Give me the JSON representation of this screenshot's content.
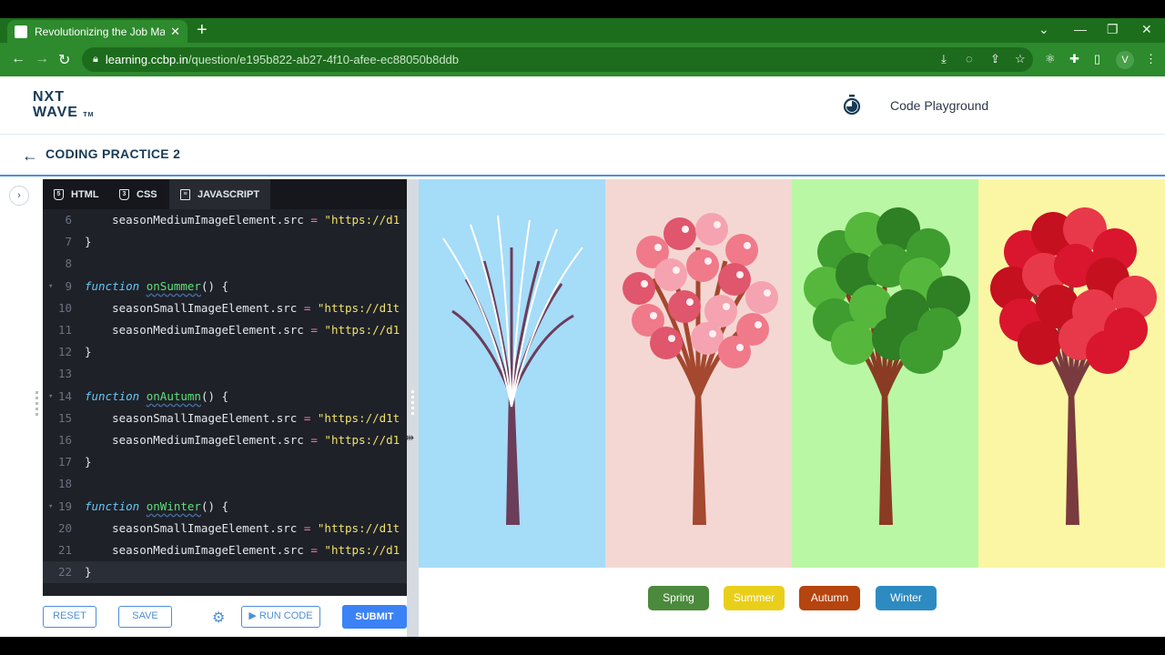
{
  "browser": {
    "tab_title": "Revolutionizing the Job Market |",
    "tab_close": "✕",
    "new_tab": "+",
    "url_host": "learning.ccbp.in",
    "url_path": "/question/e195b822-ab27-4f10-afee-ec88050b8ddb",
    "profile_initial": "V"
  },
  "header": {
    "logo_line1": "NXT",
    "logo_line2": "WAVE",
    "logo_tm": "TM",
    "playground_label": "Code Playground"
  },
  "practice": {
    "title": "CODING PRACTICE 2"
  },
  "editor": {
    "tabs": [
      {
        "label": "HTML"
      },
      {
        "label": "CSS"
      },
      {
        "label": "JAVASCRIPT"
      }
    ],
    "lines": [
      {
        "n": "6",
        "fold": "",
        "parts": [
          [
            "",
            "    seasonMediumImageElement.src "
          ],
          [
            "op",
            "="
          ],
          [
            "",
            " "
          ],
          [
            "str",
            "\"https://d1"
          ]
        ]
      },
      {
        "n": "7",
        "fold": "",
        "parts": [
          [
            "",
            "}"
          ]
        ]
      },
      {
        "n": "8",
        "fold": "",
        "parts": [
          [
            "",
            ""
          ]
        ]
      },
      {
        "n": "9",
        "fold": "▾",
        "parts": [
          [
            "kw",
            "function"
          ],
          [
            "",
            " "
          ],
          [
            "fn",
            "onSummer"
          ],
          [
            "",
            "() {"
          ]
        ]
      },
      {
        "n": "10",
        "fold": "",
        "parts": [
          [
            "",
            "    seasonSmallImageElement.src "
          ],
          [
            "op",
            "="
          ],
          [
            "",
            " "
          ],
          [
            "str",
            "\"https://d1t"
          ]
        ]
      },
      {
        "n": "11",
        "fold": "",
        "parts": [
          [
            "",
            "    seasonMediumImageElement.src "
          ],
          [
            "op",
            "="
          ],
          [
            "",
            " "
          ],
          [
            "str",
            "\"https://d1"
          ]
        ]
      },
      {
        "n": "12",
        "fold": "",
        "parts": [
          [
            "",
            "}"
          ]
        ]
      },
      {
        "n": "13",
        "fold": "",
        "parts": [
          [
            "",
            ""
          ]
        ]
      },
      {
        "n": "14",
        "fold": "▾",
        "parts": [
          [
            "kw",
            "function"
          ],
          [
            "",
            " "
          ],
          [
            "fn",
            "onAutumn"
          ],
          [
            "",
            "() {"
          ]
        ]
      },
      {
        "n": "15",
        "fold": "",
        "parts": [
          [
            "",
            "    seasonSmallImageElement.src "
          ],
          [
            "op",
            "="
          ],
          [
            "",
            " "
          ],
          [
            "str",
            "\"https://d1t"
          ]
        ]
      },
      {
        "n": "16",
        "fold": "",
        "parts": [
          [
            "",
            "    seasonMediumImageElement.src "
          ],
          [
            "op",
            "="
          ],
          [
            "",
            " "
          ],
          [
            "str",
            "\"https://d1"
          ]
        ]
      },
      {
        "n": "17",
        "fold": "",
        "parts": [
          [
            "",
            "}"
          ]
        ]
      },
      {
        "n": "18",
        "fold": "",
        "parts": [
          [
            "",
            ""
          ]
        ]
      },
      {
        "n": "19",
        "fold": "▾",
        "parts": [
          [
            "kw",
            "function"
          ],
          [
            "",
            " "
          ],
          [
            "fn",
            "onWinter"
          ],
          [
            "",
            "() {"
          ]
        ]
      },
      {
        "n": "20",
        "fold": "",
        "parts": [
          [
            "",
            "    seasonSmallImageElement.src "
          ],
          [
            "op",
            "="
          ],
          [
            "",
            " "
          ],
          [
            "str",
            "\"https://d1t"
          ]
        ]
      },
      {
        "n": "21",
        "fold": "",
        "parts": [
          [
            "",
            "    seasonMediumImageElement.src "
          ],
          [
            "op",
            "="
          ],
          [
            "",
            " "
          ],
          [
            "str",
            "\"https://d1"
          ]
        ]
      },
      {
        "n": "22",
        "fold": "",
        "parts": [
          [
            "",
            "}"
          ]
        ]
      }
    ],
    "current_line": "22",
    "buttons": {
      "reset": "RESET",
      "save": "SAVE",
      "run": "▶ RUN CODE",
      "submit": "SUBMIT"
    }
  },
  "preview": {
    "panels": [
      {
        "season": "winter",
        "bg": "#a5dcf8"
      },
      {
        "season": "spring",
        "bg": "#f4d7d3"
      },
      {
        "season": "summer",
        "bg": "#b9f7a4"
      },
      {
        "season": "autumn",
        "bg": "#fbf6a4"
      }
    ],
    "season_buttons": [
      {
        "label": "Spring",
        "color": "#4b8a3c"
      },
      {
        "label": "Summer",
        "color": "#e9cf1a"
      },
      {
        "label": "Autumn",
        "color": "#b5440e"
      },
      {
        "label": "Winter",
        "color": "#2d8bc1"
      }
    ]
  }
}
